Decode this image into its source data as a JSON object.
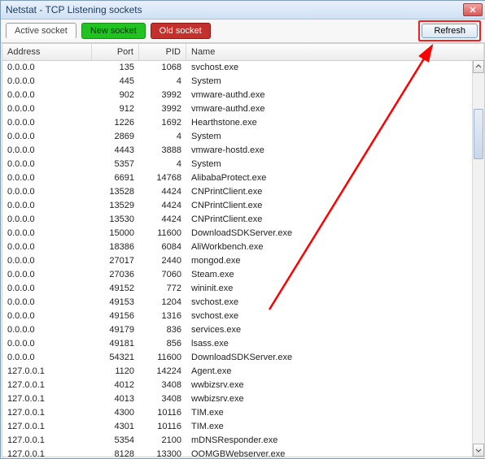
{
  "window": {
    "title": "Netstat - TCP Listening sockets"
  },
  "tabs": {
    "active": "Active socket",
    "new": "New socket",
    "old": "Old socket"
  },
  "buttons": {
    "refresh": "Refresh"
  },
  "columns": {
    "address": "Address",
    "port": "Port",
    "pid": "PID",
    "name": "Name"
  },
  "rows": [
    {
      "address": "0.0.0.0",
      "port": "135",
      "pid": "1068",
      "name": "svchost.exe"
    },
    {
      "address": "0.0.0.0",
      "port": "445",
      "pid": "4",
      "name": "System"
    },
    {
      "address": "0.0.0.0",
      "port": "902",
      "pid": "3992",
      "name": "vmware-authd.exe"
    },
    {
      "address": "0.0.0.0",
      "port": "912",
      "pid": "3992",
      "name": "vmware-authd.exe"
    },
    {
      "address": "0.0.0.0",
      "port": "1226",
      "pid": "1692",
      "name": "Hearthstone.exe"
    },
    {
      "address": "0.0.0.0",
      "port": "2869",
      "pid": "4",
      "name": "System"
    },
    {
      "address": "0.0.0.0",
      "port": "4443",
      "pid": "3888",
      "name": "vmware-hostd.exe"
    },
    {
      "address": "0.0.0.0",
      "port": "5357",
      "pid": "4",
      "name": "System"
    },
    {
      "address": "0.0.0.0",
      "port": "6691",
      "pid": "14768",
      "name": "AlibabaProtect.exe"
    },
    {
      "address": "0.0.0.0",
      "port": "13528",
      "pid": "4424",
      "name": "CNPrintClient.exe"
    },
    {
      "address": "0.0.0.0",
      "port": "13529",
      "pid": "4424",
      "name": "CNPrintClient.exe"
    },
    {
      "address": "0.0.0.0",
      "port": "13530",
      "pid": "4424",
      "name": "CNPrintClient.exe"
    },
    {
      "address": "0.0.0.0",
      "port": "15000",
      "pid": "11600",
      "name": "DownloadSDKServer.exe"
    },
    {
      "address": "0.0.0.0",
      "port": "18386",
      "pid": "6084",
      "name": "AliWorkbench.exe"
    },
    {
      "address": "0.0.0.0",
      "port": "27017",
      "pid": "2440",
      "name": "mongod.exe"
    },
    {
      "address": "0.0.0.0",
      "port": "27036",
      "pid": "7060",
      "name": "Steam.exe"
    },
    {
      "address": "0.0.0.0",
      "port": "49152",
      "pid": "772",
      "name": "wininit.exe"
    },
    {
      "address": "0.0.0.0",
      "port": "49153",
      "pid": "1204",
      "name": "svchost.exe"
    },
    {
      "address": "0.0.0.0",
      "port": "49156",
      "pid": "1316",
      "name": "svchost.exe"
    },
    {
      "address": "0.0.0.0",
      "port": "49179",
      "pid": "836",
      "name": "services.exe"
    },
    {
      "address": "0.0.0.0",
      "port": "49181",
      "pid": "856",
      "name": "lsass.exe"
    },
    {
      "address": "0.0.0.0",
      "port": "54321",
      "pid": "11600",
      "name": "DownloadSDKServer.exe"
    },
    {
      "address": "127.0.0.1",
      "port": "1120",
      "pid": "14224",
      "name": "Agent.exe"
    },
    {
      "address": "127.0.0.1",
      "port": "4012",
      "pid": "3408",
      "name": "wwbizsrv.exe"
    },
    {
      "address": "127.0.0.1",
      "port": "4013",
      "pid": "3408",
      "name": "wwbizsrv.exe"
    },
    {
      "address": "127.0.0.1",
      "port": "4300",
      "pid": "10116",
      "name": "TIM.exe"
    },
    {
      "address": "127.0.0.1",
      "port": "4301",
      "pid": "10116",
      "name": "TIM.exe"
    },
    {
      "address": "127.0.0.1",
      "port": "5354",
      "pid": "2100",
      "name": "mDNSResponder.exe"
    },
    {
      "address": "127.0.0.1",
      "port": "8128",
      "pid": "13300",
      "name": "QQMGBWebserver.exe"
    }
  ],
  "annotation": {
    "arrow_color": "#ff0000"
  }
}
